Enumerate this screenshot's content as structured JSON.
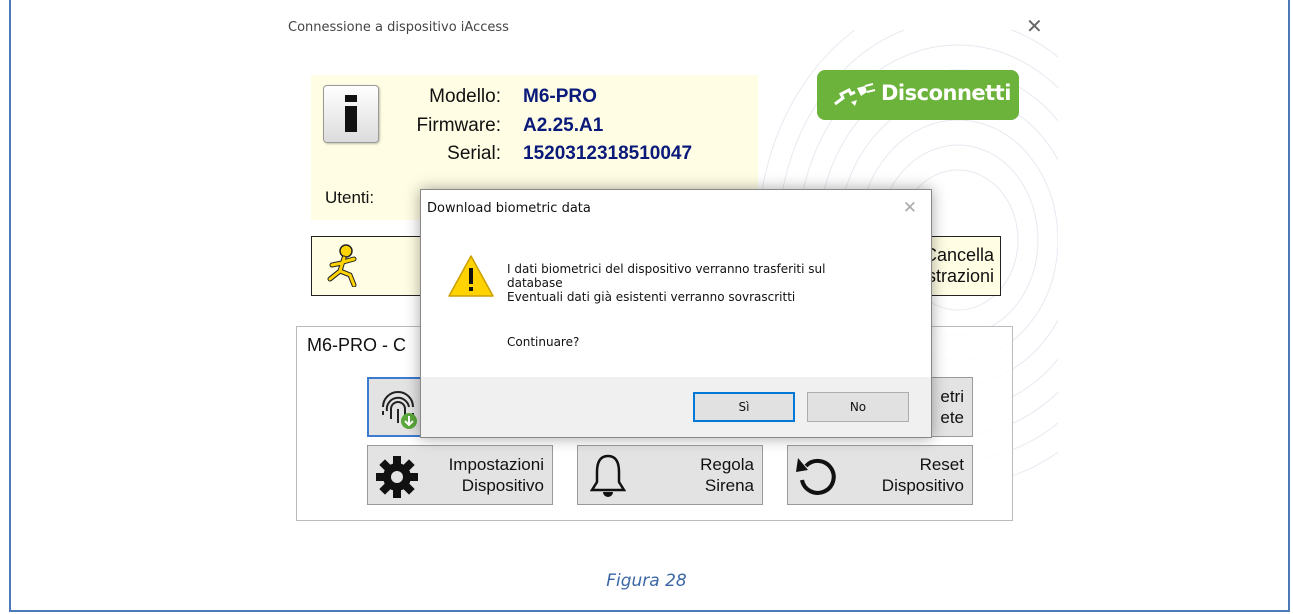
{
  "window": {
    "title": "Connessione a dispositivo iAccess",
    "close_glyph": "✕"
  },
  "device": {
    "model_label": "Modello:",
    "model": "M6-PRO",
    "firmware_label": "Firmware:",
    "firmware": "A2.25.A1",
    "serial_label": "Serial:",
    "serial": "1520312318510047",
    "users_label": "Utenti:",
    "icon": "info-icon"
  },
  "disconnect_button": {
    "label": "Disconnetti",
    "icon": "plug-disconnect-icon",
    "color": "#6bb33a"
  },
  "actions_row": {
    "icon": "aim-user-icon",
    "cancella_line1": "Cancella",
    "cancella_line2": "strazioni"
  },
  "group": {
    "title": "M6-PRO - C",
    "buttons": [
      {
        "line1": "",
        "line2": "",
        "icon": "fingerprint-download-icon"
      },
      {
        "line1": "etri",
        "line2": "ete",
        "icon": ""
      },
      {
        "line1": "Impostazioni",
        "line2": "Dispositivo",
        "icon": "gear-icon"
      },
      {
        "line1": "Regola",
        "line2": "Sirena",
        "icon": "bell-icon"
      },
      {
        "line1": "Reset",
        "line2": "Dispositivo",
        "icon": "reset-icon"
      }
    ]
  },
  "dialog": {
    "title": "Download biometric data",
    "close_glyph": "✕",
    "icon": "warning-icon",
    "line1": "I dati biometrici del dispositivo verranno trasferiti sul",
    "line2": "database",
    "line3": "Eventuali dati già esistenti verranno sovrascritti",
    "question": "Continuare?",
    "yes_label": "Sì",
    "no_label": "No"
  },
  "caption": "Figura 28",
  "colors": {
    "frame": "#4a7bb7",
    "info_bg": "#fffde3",
    "value_text": "#0a1a7a",
    "default_button": "#0078d7"
  }
}
